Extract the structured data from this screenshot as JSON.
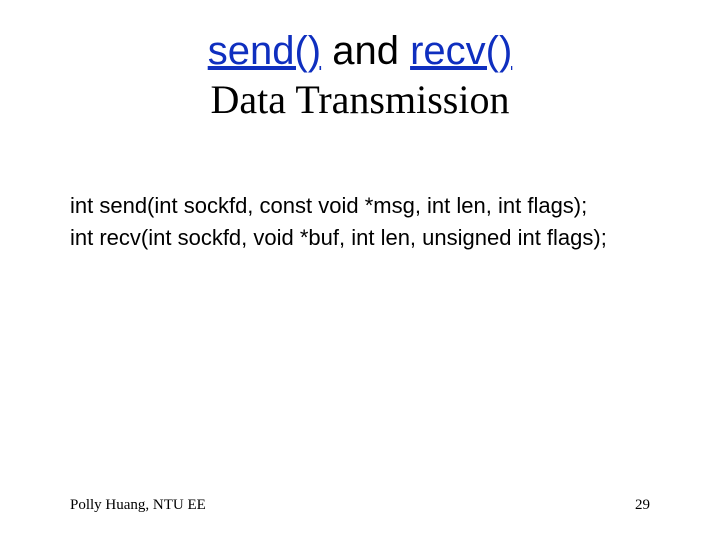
{
  "title": {
    "fn1": "send()",
    "conj": " and ",
    "fn2": "recv()",
    "subtitle": "Data Transmission"
  },
  "body": {
    "line1": "int send(int sockfd, const void *msg, int len, int flags);",
    "line2": "int recv(int sockfd, void *buf, int len, unsigned int flags);"
  },
  "footer": {
    "author": "Polly Huang, NTU EE",
    "page": "29"
  }
}
